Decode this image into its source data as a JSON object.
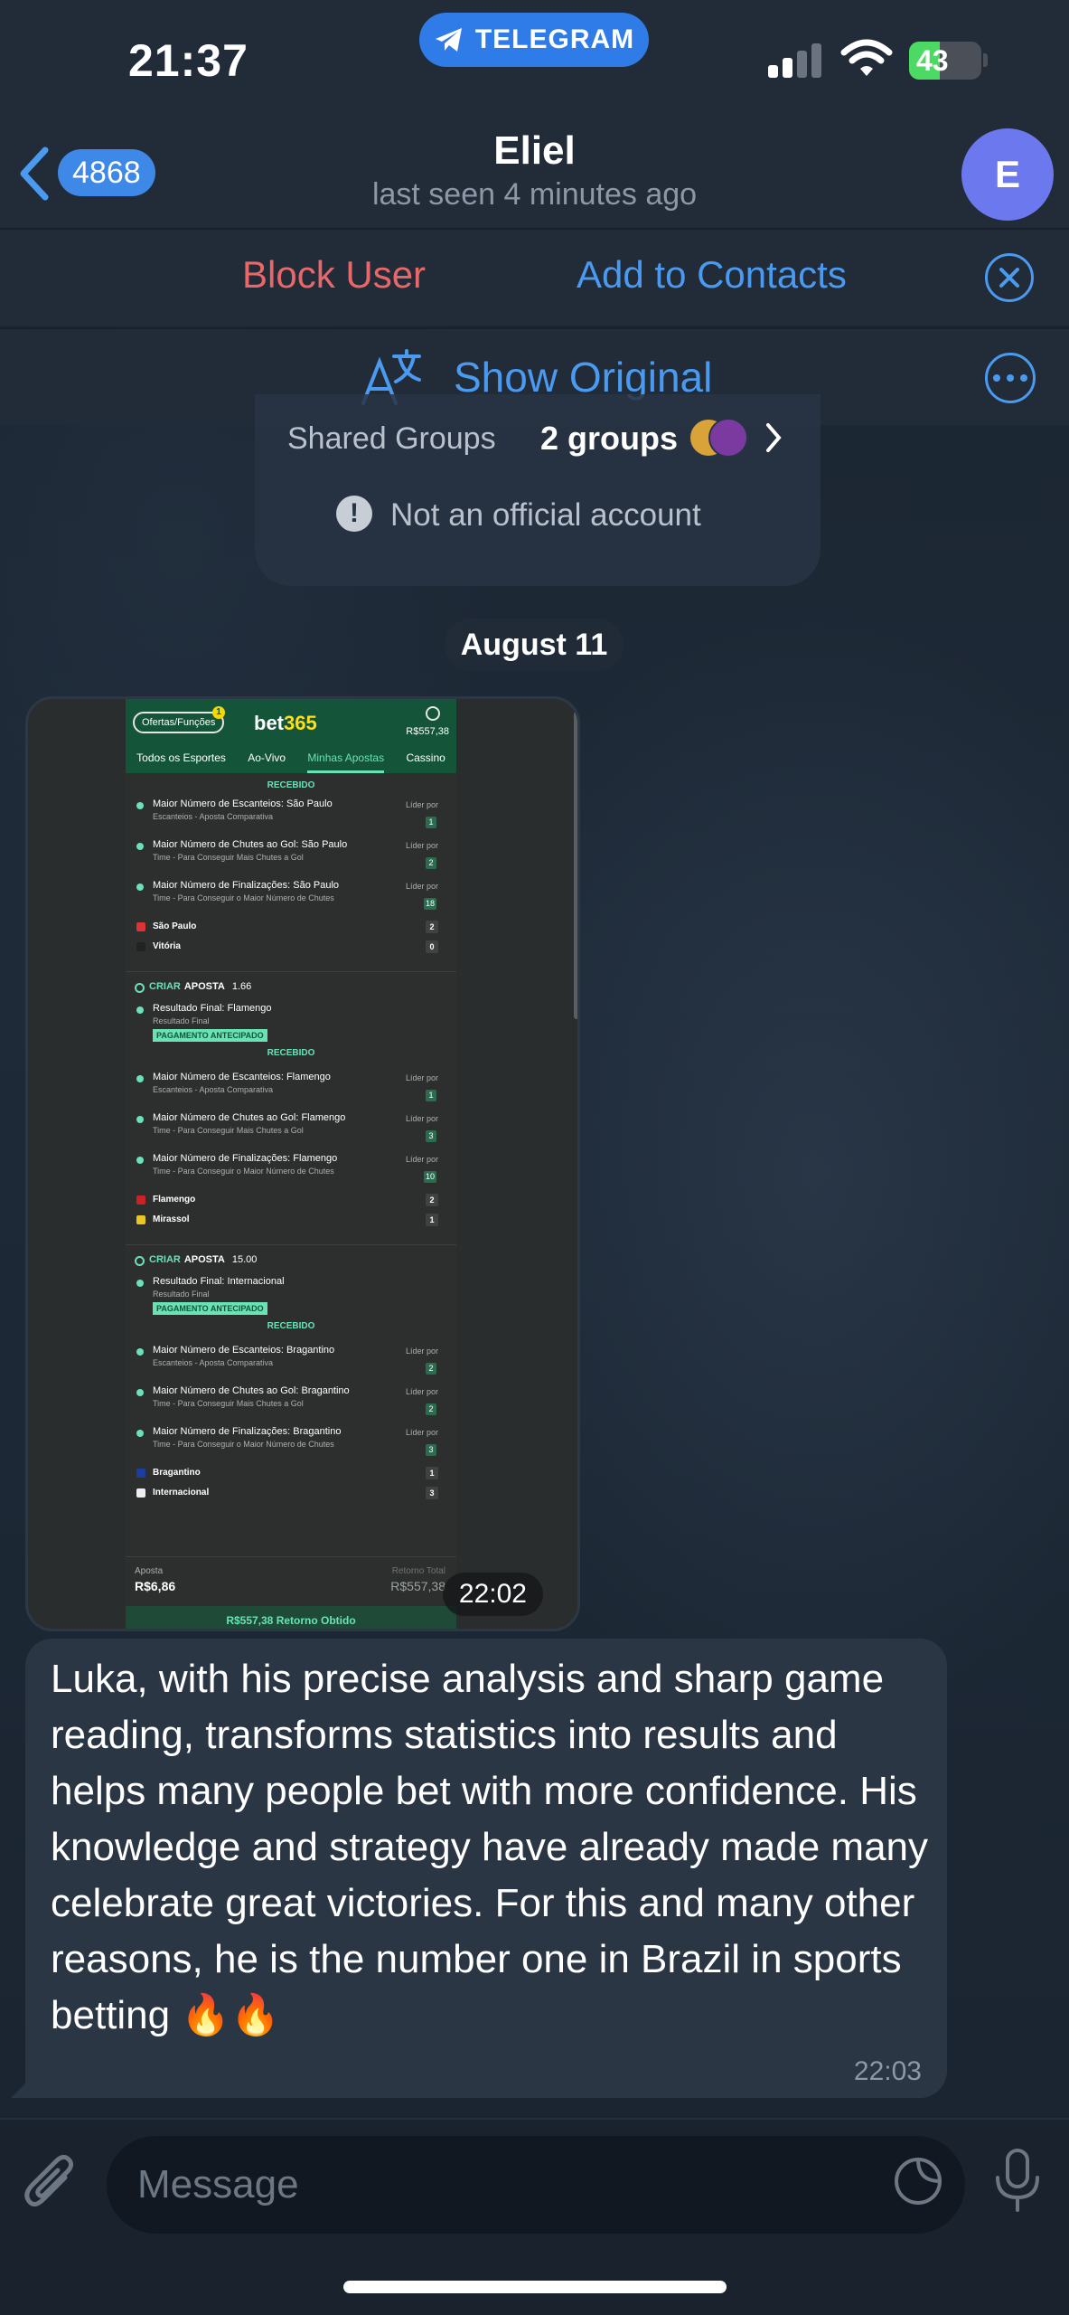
{
  "status_bar": {
    "time": "21:37",
    "app_badge": "TELEGRAM",
    "battery_level": "43",
    "battery_fraction": 0.43,
    "charging": true
  },
  "header": {
    "back_count": "4868",
    "name": "Eliel",
    "status": "last seen 4 minutes ago",
    "avatar_initial": "E",
    "avatar_color": "#6c78ee"
  },
  "actions": {
    "block_user": "Block User",
    "add_contacts": "Add to Contacts",
    "show_original": "Show Original"
  },
  "info_card": {
    "shared_groups_label": "Shared Groups",
    "shared_groups_value": "2 groups",
    "not_official": "Not an official account"
  },
  "date_separator": "August 11",
  "photo_message": {
    "time": "22:02",
    "bet_screenshot": {
      "offers_label": "Ofertas/Funções",
      "offers_count": "1",
      "logo_main": "bet",
      "logo_accent": "365",
      "balance": "R$557,38",
      "tabs": [
        "Todos os Esportes",
        "Ao-Vivo",
        "Minhas Apostas",
        "Cassino"
      ],
      "active_tab": "Minhas Apostas",
      "recebido_label": "RECEBIDO",
      "block1": {
        "markets": [
          {
            "name": "Maior Número de Escanteios: São Paulo",
            "sub": "Escanteios - Aposta Comparativa",
            "lider": "Líder por",
            "count": "1"
          },
          {
            "name": "Maior Número de Chutes ao Gol: São Paulo",
            "sub": "Time - Para Conseguir Mais Chutes a Gol",
            "lider": "Líder por",
            "count": "2"
          },
          {
            "name": "Maior Número de Finalizações: São Paulo",
            "sub": "Time - Para Conseguir o Maior Número de Chutes",
            "lider": "Líder por",
            "count": "18"
          }
        ],
        "teams": [
          {
            "name": "São Paulo",
            "score": "2",
            "color": "#d33"
          },
          {
            "name": "Vitória",
            "score": "0",
            "color": "#222"
          }
        ]
      },
      "block2": {
        "criar": "CRIAR",
        "aposta": "APOSTA",
        "odd": "1.66",
        "result_name": "Resultado Final: Flamengo",
        "result_sub": "Resultado Final",
        "paid": "PAGAMENTO ANTECIPADO",
        "markets": [
          {
            "name": "Maior Número de Escanteios: Flamengo",
            "sub": "Escanteios - Aposta Comparativa",
            "lider": "Líder por",
            "count": "1"
          },
          {
            "name": "Maior Número de Chutes ao Gol: Flamengo",
            "sub": "Time - Para Conseguir Mais Chutes a Gol",
            "lider": "Líder por",
            "count": "3"
          },
          {
            "name": "Maior Número de Finalizações: Flamengo",
            "sub": "Time - Para Conseguir o Maior Número de Chutes",
            "lider": "Líder por",
            "count": "10"
          }
        ],
        "teams": [
          {
            "name": "Flamengo",
            "score": "2",
            "color": "#c22"
          },
          {
            "name": "Mirassol",
            "score": "1",
            "color": "#e8c820"
          }
        ]
      },
      "block3": {
        "criar": "CRIAR",
        "aposta": "APOSTA",
        "odd": "15.00",
        "result_name": "Resultado Final: Internacional",
        "result_sub": "Resultado Final",
        "paid": "PAGAMENTO ANTECIPADO",
        "markets": [
          {
            "name": "Maior Número de Escanteios: Bragantino",
            "sub": "Escanteios - Aposta Comparativa",
            "lider": "Líder por",
            "count": "2"
          },
          {
            "name": "Maior Número de Chutes ao Gol: Bragantino",
            "sub": "Time - Para Conseguir Mais Chutes a Gol",
            "lider": "Líder por",
            "count": "2"
          },
          {
            "name": "Maior Número de Finalizações: Bragantino",
            "sub": "Time - Para Conseguir o Maior Número de Chutes",
            "lider": "Líder por",
            "count": "3"
          }
        ],
        "teams": [
          {
            "name": "Bragantino",
            "score": "1",
            "color": "#1a3fa0"
          },
          {
            "name": "Internacional",
            "score": "3",
            "color": "#eee"
          }
        ]
      },
      "aposta_label": "Aposta",
      "aposta_value": "R$6,86",
      "retorno_label": "Retorno Total",
      "retorno_value": "R$557,38",
      "retorno_obtido": "R$557,38  Retorno Obtido"
    }
  },
  "text_message": {
    "body": "Luka, with his precise analysis and sharp game reading, transforms statistics into results and helps many people bet with more confidence. His knowledge and strategy have already made many celebrate great victories. For this and many other reasons, he is the number one in Brazil in sports betting 🔥🔥",
    "time": "22:03"
  },
  "input": {
    "placeholder": "Message"
  },
  "colors": {
    "accent": "#4a9af0",
    "danger": "#e8686a",
    "bubble": "#2b3644",
    "bet_green": "#69e2b6"
  }
}
